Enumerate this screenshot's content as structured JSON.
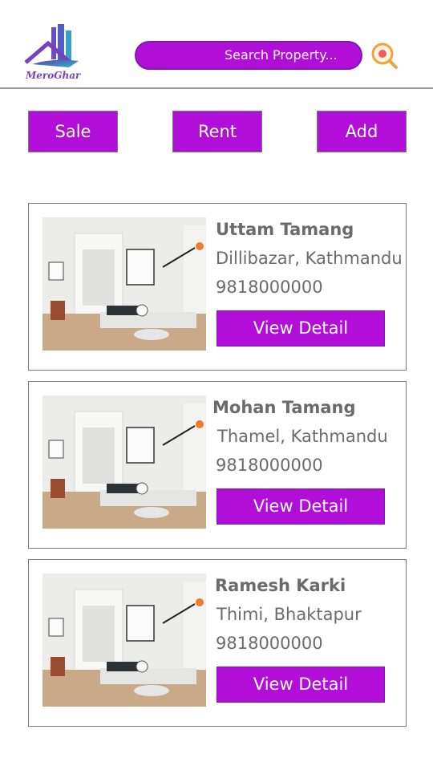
{
  "app": {
    "logo_text": "MeroGhar"
  },
  "search": {
    "placeholder": "Search Property..."
  },
  "categories": [
    {
      "label": "Sale"
    },
    {
      "label": "Rent"
    },
    {
      "label": "Add"
    }
  ],
  "listings": [
    {
      "owner": "Uttam Tamang",
      "address": "Dillibazar, Kathmandu",
      "phone": "9818000000",
      "action": "View Detail"
    },
    {
      "owner": "Mohan Tamang",
      "address": "Thamel, Kathmandu",
      "phone": "9818000000",
      "action": "View Detail"
    },
    {
      "owner": "Ramesh Karki",
      "address": "Thimi, Bhaktapur",
      "phone": "9818000000",
      "action": "View Detail"
    }
  ],
  "colors": {
    "accent": "#b10fd8",
    "border": "#7a7a7a",
    "text": "#6b6b6b"
  }
}
